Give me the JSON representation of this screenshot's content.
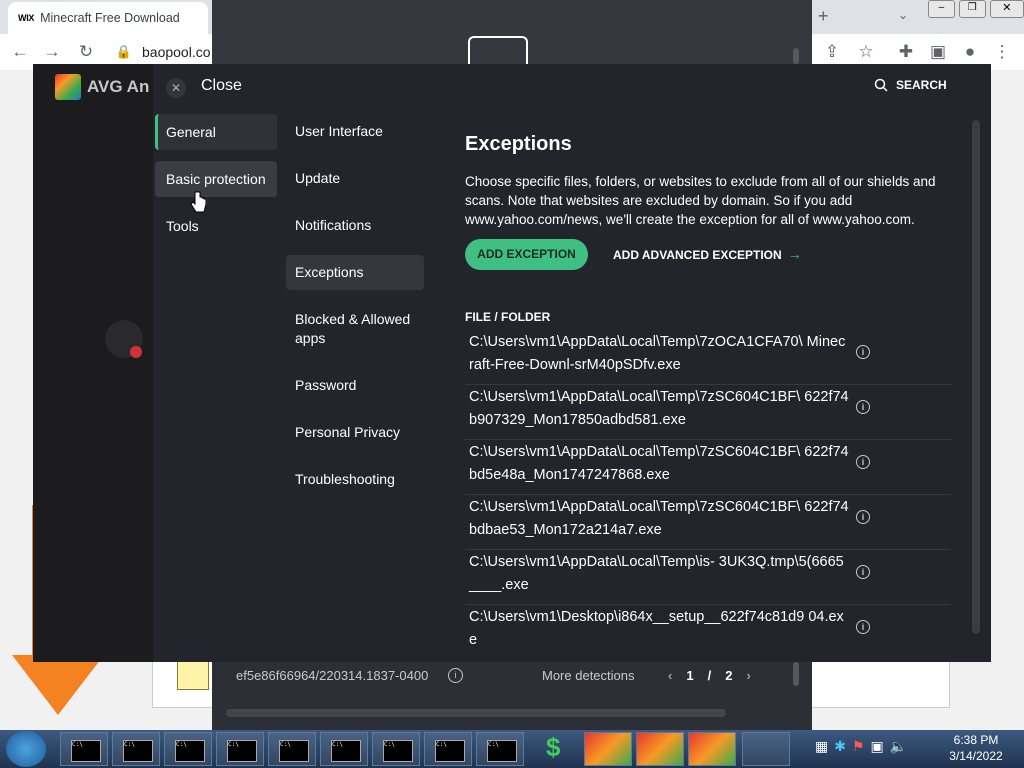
{
  "browser": {
    "tab_title": "Minecraft Free Download",
    "tab_icon": "WIX",
    "url": "baopool.co"
  },
  "behind": {
    "footer_id": "ef5e86f66964/220314.1837-0400",
    "more_detections": "More detections",
    "page_current": "1",
    "page_sep": "/",
    "page_total": "2"
  },
  "avg": {
    "logo": "AVG An"
  },
  "settings": {
    "close_label": "Close",
    "search_label": "SEARCH",
    "nav_primary": [
      {
        "label": "General"
      },
      {
        "label": "Basic protection"
      },
      {
        "label": "Tools"
      }
    ],
    "nav_secondary": [
      {
        "label": "User Interface"
      },
      {
        "label": "Update"
      },
      {
        "label": "Notifications"
      },
      {
        "label": "Exceptions"
      },
      {
        "label": "Blocked & Allowed apps"
      },
      {
        "label": "Password"
      },
      {
        "label": "Personal Privacy"
      },
      {
        "label": "Troubleshooting"
      }
    ],
    "title": "Exceptions",
    "description": "Choose specific files, folders, or websites to exclude from all of our shields and scans. Note that websites are excluded by domain. So if you add www.yahoo.com/news, we'll create the exception for all of www.yahoo.com.",
    "add_exception": "ADD EXCEPTION",
    "add_advanced": "ADD ADVANCED EXCEPTION",
    "file_folder_label": "FILE / FOLDER",
    "exceptions": [
      "C:\\Users\\vm1\\AppData\\Local\\Temp\\7zOCA1CFA70\\ Minecraft-Free-Downl-srM40pSDfv.exe",
      "C:\\Users\\vm1\\AppData\\Local\\Temp\\7zSC604C1BF\\ 622f74b907329_Mon17850adbd581.exe",
      "C:\\Users\\vm1\\AppData\\Local\\Temp\\7zSC604C1BF\\ 622f74bd5e48a_Mon1747247868.exe",
      "C:\\Users\\vm1\\AppData\\Local\\Temp\\7zSC604C1BF\\ 622f74bdbae53_Mon172a214a7.exe",
      "C:\\Users\\vm1\\AppData\\Local\\Temp\\is- 3UK3Q.tmp\\5(6665____.exe",
      "C:\\Users\\vm1\\Desktop\\i864x__setup__622f74c81d9 04.exe"
    ]
  },
  "taskbar": {
    "time": "6:38 PM",
    "date": "3/14/2022",
    "cmd_label": "C:\\"
  },
  "colors": {
    "accent": "#3fc082",
    "panel_bg": "#22252b",
    "orange": "#f58220"
  }
}
